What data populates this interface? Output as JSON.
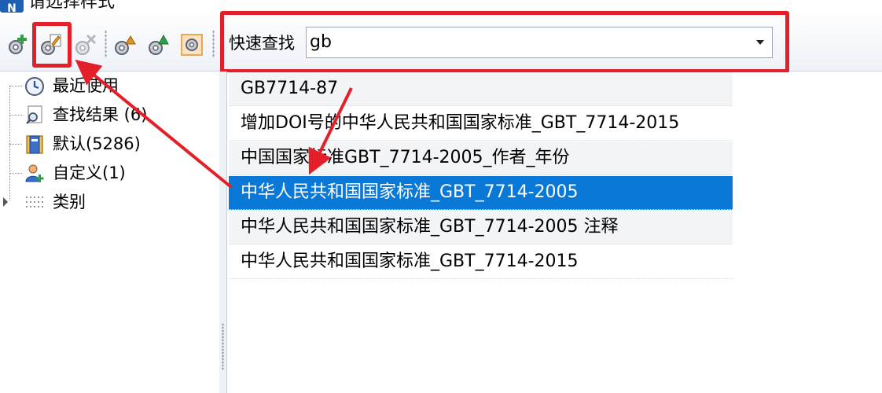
{
  "window": {
    "title": "请选择样式"
  },
  "toolbar": {
    "buttons": [
      {
        "name": "add-style-icon"
      },
      {
        "name": "edit-style-icon"
      },
      {
        "name": "delete-style-icon"
      },
      {
        "name": "import-style-icon"
      },
      {
        "name": "export-style-icon"
      },
      {
        "name": "style-settings-icon"
      }
    ],
    "search_label": "快速查找",
    "search_value": "gb"
  },
  "tree": {
    "items": [
      {
        "label": "最近使用",
        "icon": "clock-icon"
      },
      {
        "label": "查找结果 (6)",
        "icon": "search-result-icon"
      },
      {
        "label": "默认(5286)",
        "icon": "book-icon"
      },
      {
        "label": "自定义(1)",
        "icon": "user-add-icon"
      },
      {
        "label": "类别",
        "icon": "category-grid-icon"
      }
    ]
  },
  "list": {
    "items": [
      "GB7714-87",
      "增加DOI号的中华人民共和国国家标准_GBT_7714-2015",
      "中国国家标准GBT_7714-2005_作者_年份",
      "中华人民共和国国家标准_GBT_7714-2005",
      "中华人民共和国国家标准_GBT_7714-2005 注释",
      "中华人民共和国国家标准_GBT_7714-2015"
    ],
    "selected_index": 3
  },
  "colors": {
    "selection": "#0a78d7",
    "annotation_red": "#e3202a"
  }
}
